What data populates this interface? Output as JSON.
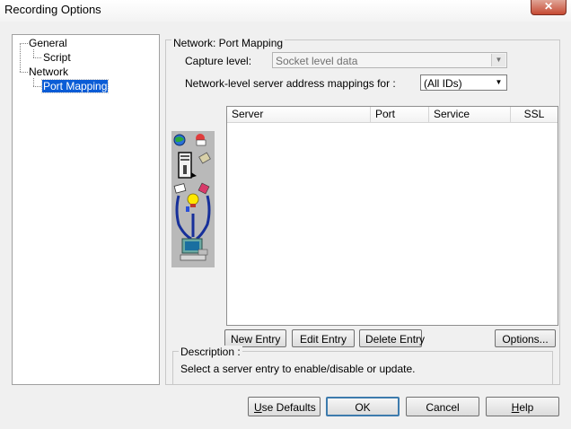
{
  "window": {
    "title": "Recording Options",
    "close_glyph": "✕"
  },
  "tree": {
    "items": [
      {
        "label": "General"
      },
      {
        "label": "Script"
      },
      {
        "label": "Network"
      },
      {
        "label": "Port Mapping",
        "selected": true
      }
    ]
  },
  "port_mapping": {
    "group_title": "Network: Port Mapping",
    "capture_level_label": "Capture level:",
    "capture_level_value": "Socket level data",
    "mappings_for_label": "Network-level server address mappings for :",
    "mappings_for_value": "(All IDs)",
    "columns": [
      "Server",
      "Port",
      "Service",
      "SSL"
    ],
    "rows": [],
    "buttons": {
      "new_entry": "New Entry",
      "edit_entry": "Edit Entry",
      "delete_entry": "Delete Entry",
      "options": "Options..."
    },
    "description_label": "Description :",
    "description_text": "Select a server entry to enable/disable or update."
  },
  "footer": {
    "use_defaults_prefix": "U",
    "use_defaults_rest": "se Defaults",
    "ok": "OK",
    "cancel": "Cancel",
    "help_prefix": "H",
    "help_rest": "elp"
  },
  "icons": [
    "network-graphic-icon",
    "globe-icon",
    "server-icon",
    "pencil-icon",
    "lightbulb-icon",
    "computer-icon",
    "chevron-down-icon",
    "close-icon"
  ]
}
